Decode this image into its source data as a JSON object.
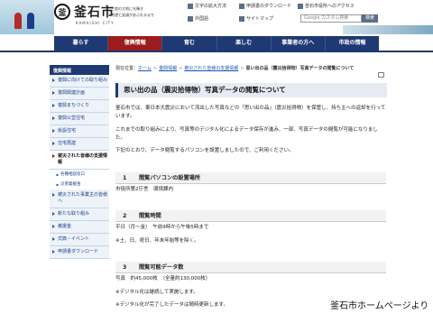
{
  "header": {
    "site_name": "釜石市",
    "site_name_en": "KAMAISHI CITY",
    "logo_glyph": "釜",
    "tagline_1": "三陸の大地に光輝き",
    "tagline_2": "希望と笑顔があふれるまち",
    "util_fontsize": "文字の拡大方法",
    "util_download": "申請書のダウンロード",
    "util_access": "釜石市役所へのアクセス",
    "util_foreign": "外国語",
    "util_sitemap": "サイトマップ",
    "search_placeholder": "Google カスタム検索",
    "search_button": "検索"
  },
  "nav": {
    "items": [
      "暮らす",
      "復興情報",
      "育む",
      "楽しむ",
      "事業者の方へ",
      "市政の情報"
    ]
  },
  "breadcrumb": {
    "prefix": "現在位置：",
    "home": "ホーム",
    "level1": "復興情報",
    "level2": "被災された皆様の支援情報",
    "current": "思い出の品（震災拾得物）写真データの閲覧について"
  },
  "sidebar": {
    "heading": "復興情報",
    "items": [
      "復興に向けての取り組み",
      "復興関連計画",
      "復興まちづくり",
      "復興公営住宅",
      "仮設住宅",
      "住宅再建",
      "被災された皆様の支援情報",
      "被災された事業主の皆様へ",
      "新たな取り組み",
      "義援金",
      "式典・イベント",
      "申請書ダウンロード"
    ],
    "subitems": [
      "各種相談窓口",
      "災害義援金"
    ]
  },
  "main": {
    "title": "思い出の品（震災拾得物）写真データの閲覧について",
    "intro_1": "釜石市では、東日本大震災において流出した写真などの「思い出の品」（震災拾得物）を保管し、持ち主への返却を行っています。",
    "intro_2": "これまでの取り組みにより、写真等のデジタル化によるデータ保存が進み、一部、写真データの閲覧が可能になりました。",
    "intro_3": "下記のとおり、データ閲覧するパソコンを設置しましたので、ご利用ください。",
    "sections": [
      {
        "num": "1",
        "title": "閲覧パソコンの設置場所",
        "lines": [
          "市役所第2庁舎　環境課内"
        ]
      },
      {
        "num": "2",
        "title": "閲覧時間",
        "lines": [
          "平日（月～金）　午前9時から午後5時まで",
          "※土、日、祝日、年末年始等を除く。"
        ]
      },
      {
        "num": "3",
        "title": "閲覧可能データ数",
        "lines": [
          "写真　約45,000枚　（全量約130,000枚）",
          "※デジタル化は継続して実施します。",
          "※デジタル化が完了したデータは随時更新します。"
        ]
      }
    ]
  },
  "caption": "釜石市ホームページより",
  "colors": {
    "nav_bg": "#1f3a72",
    "nav_active": "#9b1c1c",
    "link": "#1a56b3"
  }
}
